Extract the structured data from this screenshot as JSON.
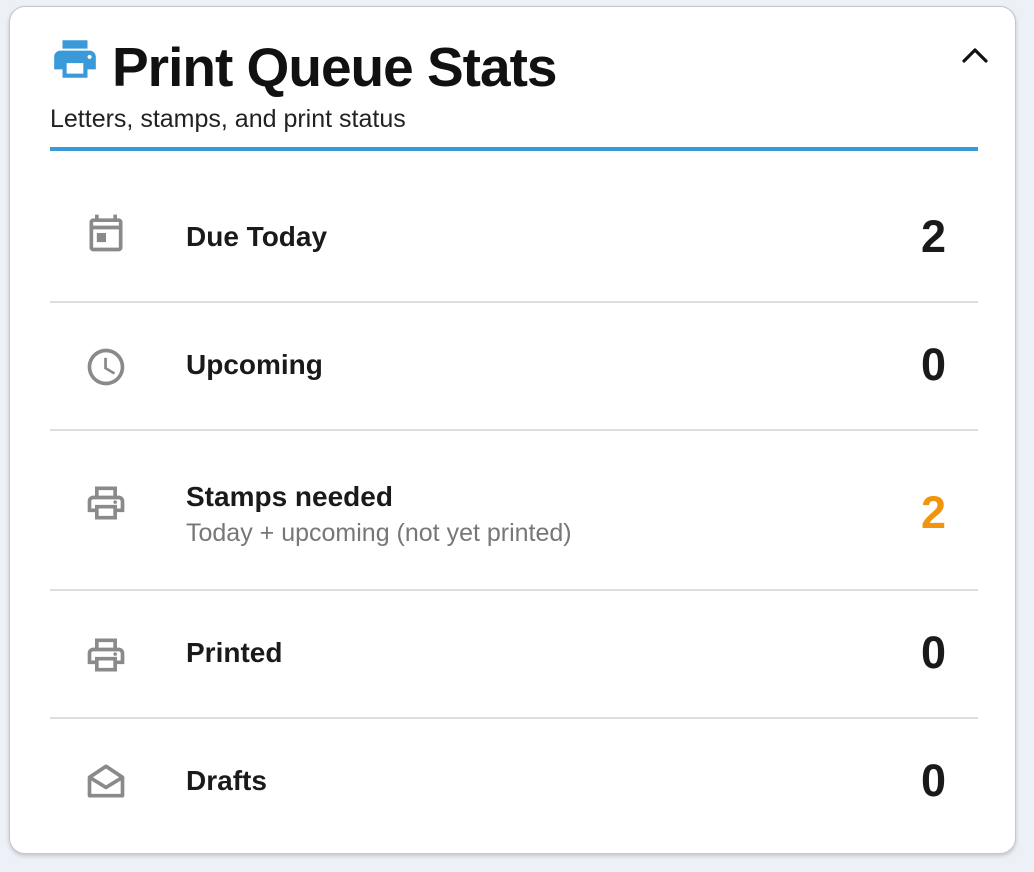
{
  "card": {
    "title": "Print Queue Stats",
    "subtitle": "Letters, stamps, and print status"
  },
  "colors": {
    "accent": "#3a9ad9",
    "highlight_value": "#f0950c",
    "icon_gray": "#8a8a8a"
  },
  "stats": [
    {
      "label": "Due Today",
      "sublabel": "",
      "value": "2",
      "icon": "calendar-icon"
    },
    {
      "label": "Upcoming",
      "sublabel": "",
      "value": "0",
      "icon": "clock-icon"
    },
    {
      "label": "Stamps needed",
      "sublabel": "Today + upcoming (not yet printed)",
      "value": "2",
      "icon": "printer-icon",
      "highlight": true
    },
    {
      "label": "Printed",
      "sublabel": "",
      "value": "0",
      "icon": "printer-icon"
    },
    {
      "label": "Drafts",
      "sublabel": "",
      "value": "0",
      "icon": "envelope-open-icon"
    }
  ]
}
